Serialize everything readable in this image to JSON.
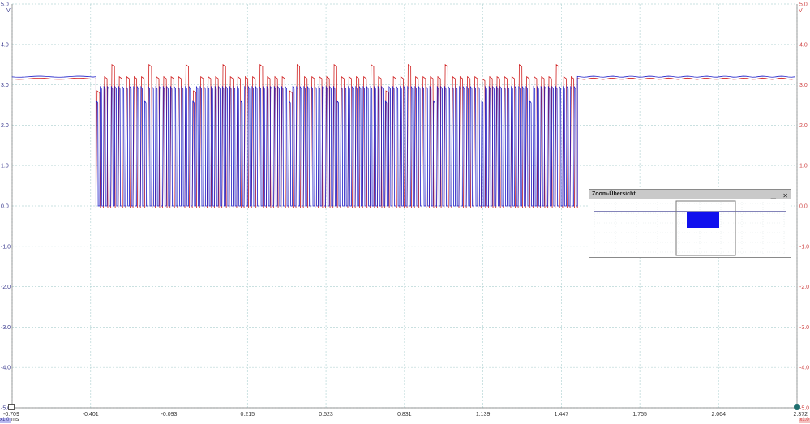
{
  "scope": {
    "left_axis_unit": "V",
    "right_axis_unit": "V",
    "left_axis_ticks": [
      "5.0",
      "4.0",
      "3.0",
      "2.0",
      "1.0",
      "0.0",
      "-1.0",
      "-2.0",
      "-3.0",
      "-4.0",
      "-5.0"
    ],
    "right_axis_ticks": [
      "5.0",
      "4.0",
      "3.0",
      "2.0",
      "1.0",
      "0.0",
      "-1.0",
      "-2.0",
      "-3.0",
      "-4.0",
      "-5.0"
    ],
    "x_axis_ticks": [
      "-0.709",
      "-0.401",
      "-0.093",
      "0.215",
      "0.523",
      "0.831",
      "1.139",
      "1.447",
      "1.755",
      "2.064",
      "2.372"
    ],
    "x_axis_unit": "ms",
    "channel_a_tag": "x1.0",
    "channel_b_tag": "x1.0",
    "colors": {
      "channel_a": "#1f1fc8",
      "channel_b": "#d02020",
      "grid": "#b7d6d6"
    }
  },
  "zoom_overview": {
    "title": "Zoom-Übersicht",
    "minimize_icon": "minimize-icon",
    "close_icon": "close-icon"
  },
  "chart_data": {
    "type": "line",
    "x_unit": "ms",
    "y_unit": "V",
    "xlim": [
      -0.709,
      2.372
    ],
    "ylim": [
      -5.0,
      5.0
    ],
    "grid": true,
    "series": [
      {
        "channel": "A",
        "color": "#1f1fc8",
        "idle_level": 3.2,
        "burst_start": -0.38,
        "burst_end": 1.51,
        "burst_high": 2.95,
        "burst_low": 0.0,
        "pulse_count": 130
      },
      {
        "channel": "B",
        "color": "#d02020",
        "idle_level": 3.15,
        "burst_start": -0.38,
        "burst_end": 1.51,
        "burst_high": 3.2,
        "burst_low": -0.05,
        "pulse_count": 65
      }
    ]
  }
}
